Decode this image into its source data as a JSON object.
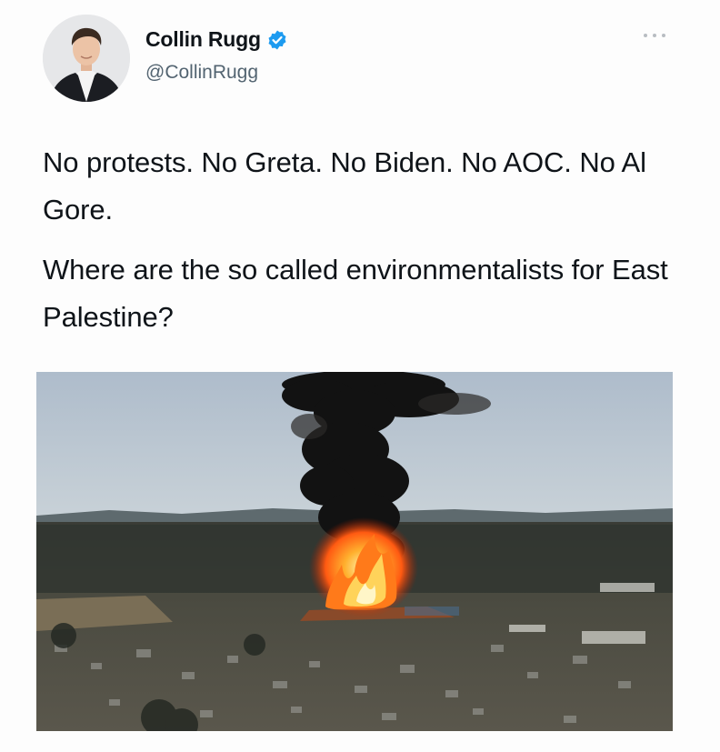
{
  "tweet": {
    "author": {
      "display_name": "Collin Rugg",
      "handle": "@CollinRugg",
      "verified": true,
      "verified_icon": "verified-badge-icon",
      "avatar_icon": "profile-photo"
    },
    "more_icon": "more-options-icon",
    "text": [
      "No protests. No Greta. No Biden. No AOC. No Al Gore.",
      "Where are the so called environmentalists for East Palestine?"
    ],
    "media": {
      "icon": "photo-smoke-plume-fire"
    }
  },
  "colors": {
    "text_primary": "#0f1419",
    "text_secondary": "#536471",
    "verified_blue": "#1d9bf0"
  }
}
